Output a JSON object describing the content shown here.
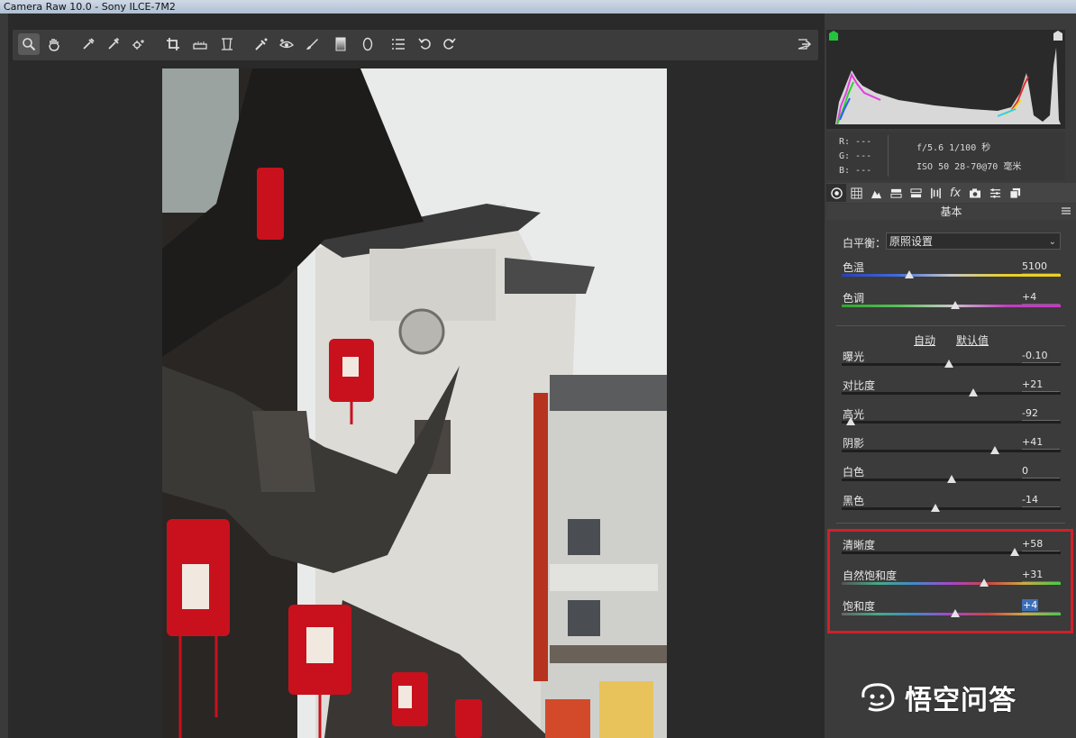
{
  "window": {
    "title": "Camera Raw 10.0 -  Sony ILCE-7M2"
  },
  "toolbar": {
    "tools": [
      "zoom-tool",
      "hand-tool",
      "white-balance-tool",
      "color-sampler-tool",
      "targeted-adjustment-tool",
      "crop-tool",
      "straighten-tool",
      "transform-tool",
      "spot-removal-tool",
      "red-eye-tool",
      "adjustment-brush",
      "graduated-filter",
      "radial-filter",
      "preferences",
      "rotate-left",
      "rotate-right"
    ],
    "active": "zoom-tool"
  },
  "camera_info": {
    "r": "R:  ---",
    "g": "G:  ---",
    "b": "B:  ---",
    "aperture_shutter": "f/5.6   1/100 秒",
    "iso_lens": "ISO 50   28-70@70 毫米"
  },
  "panel": {
    "title": "基本",
    "tabs": [
      "basic",
      "tone-curve",
      "detail",
      "hsl",
      "split-toning",
      "lens",
      "fx",
      "camera-calibration",
      "presets",
      "snapshots"
    ],
    "active_tab": "basic"
  },
  "white_balance": {
    "label": "白平衡：",
    "value": "原照设置"
  },
  "sliders_wb": [
    {
      "label": "色温",
      "value": "5100",
      "pos": 0.31
    },
    {
      "label": "色调",
      "value": "+4",
      "pos": 0.52
    }
  ],
  "auto_links": {
    "auto": "自动",
    "default": "默认值"
  },
  "sliders_tone": [
    {
      "label": "曝光",
      "value": "-0.10",
      "pos": 0.49
    },
    {
      "label": "对比度",
      "value": "+21",
      "pos": 0.6
    },
    {
      "label": "高光",
      "value": "-92",
      "pos": 0.04
    },
    {
      "label": "阴影",
      "value": "+41",
      "pos": 0.7
    },
    {
      "label": "白色",
      "value": "0",
      "pos": 0.5
    },
    {
      "label": "黑色",
      "value": "-14",
      "pos": 0.43
    }
  ],
  "sliders_presence": [
    {
      "label": "清晰度",
      "value": "+58",
      "pos": 0.79
    },
    {
      "label": "自然饱和度",
      "value": "+31",
      "pos": 0.65
    },
    {
      "label": "饱和度",
      "value": "+4",
      "pos": 0.52,
      "selected": true
    }
  ],
  "watermark": {
    "text": "悟空问答"
  },
  "colors": {
    "highlight_box": "#d0202a",
    "accent_select": "#3d6fb8"
  }
}
